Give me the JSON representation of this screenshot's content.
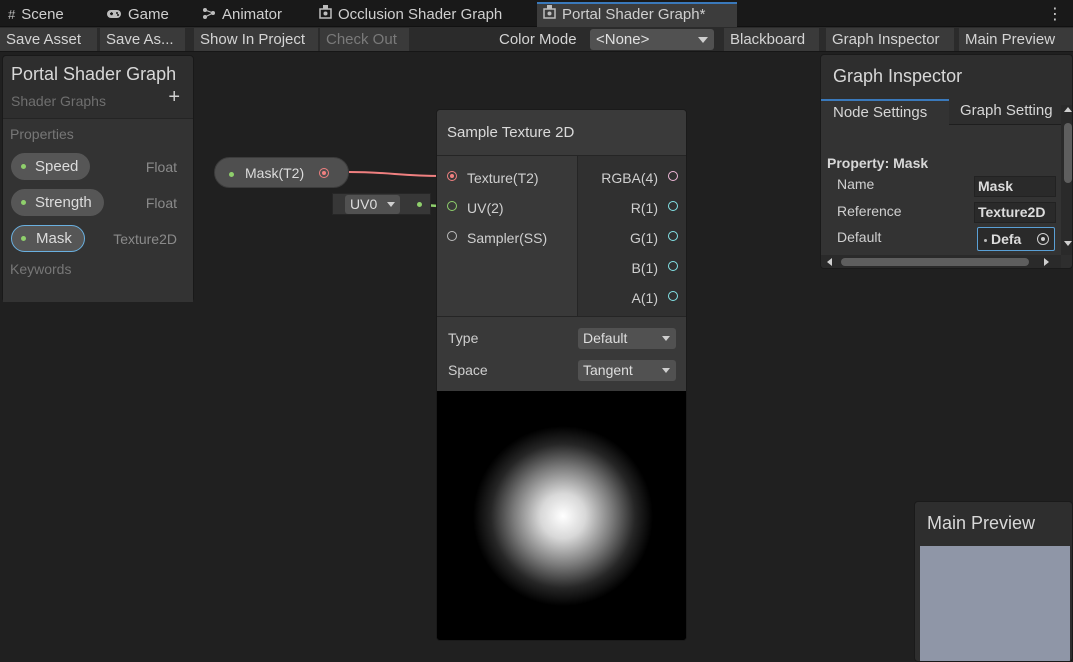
{
  "tabs": [
    {
      "label": "Scene",
      "icon": "grid-icon"
    },
    {
      "label": "Game",
      "icon": "gamepad-icon"
    },
    {
      "label": "Animator",
      "icon": "animator-icon"
    },
    {
      "label": "Occlusion Shader Graph",
      "icon": "shader-graph-icon"
    },
    {
      "label": "Portal Shader Graph*",
      "icon": "shader-graph-icon",
      "active": true
    }
  ],
  "toolbar": {
    "save_asset": "Save Asset",
    "save_as": "Save As...",
    "show_in_project": "Show In Project",
    "check_out": "Check Out",
    "color_mode_label": "Color Mode",
    "color_mode_value": "<None>",
    "blackboard": "Blackboard",
    "graph_inspector": "Graph Inspector",
    "main_preview": "Main Preview"
  },
  "blackboard": {
    "title": "Portal Shader Graph",
    "subtitle": "Shader Graphs",
    "add": "+",
    "properties_label": "Properties",
    "properties": [
      {
        "name": "Speed",
        "type": "Float"
      },
      {
        "name": "Strength",
        "type": "Float"
      },
      {
        "name": "Mask",
        "type": "Texture2D",
        "selected": true
      }
    ],
    "keywords_label": "Keywords"
  },
  "property_node": {
    "label": "Mask(T2)"
  },
  "uv_input": {
    "value": "UV0"
  },
  "sample_node": {
    "title": "Sample Texture 2D",
    "inputs": [
      "Texture(T2)",
      "UV(2)",
      "Sampler(SS)"
    ],
    "outputs": [
      "RGBA(4)",
      "R(1)",
      "G(1)",
      "B(1)",
      "A(1)"
    ],
    "type_label": "Type",
    "type_value": "Default",
    "space_label": "Space",
    "space_value": "Tangent"
  },
  "inspector": {
    "title": "Graph Inspector",
    "tab_node": "Node Settings",
    "tab_graph": "Graph Setting",
    "property_title": "Property: Mask",
    "name_label": "Name",
    "name_value": "Mask",
    "reference_label": "Reference",
    "reference_value": "Texture2D",
    "default_label": "Default",
    "default_value": "Defa"
  },
  "main_preview": {
    "title": "Main Preview"
  },
  "colors": {
    "accent": "#3a79bb",
    "texture_port": "#f08080",
    "vector2_port": "#8fd06c",
    "float_port": "#84e4e7",
    "preview_bg": "#8f96a7"
  }
}
